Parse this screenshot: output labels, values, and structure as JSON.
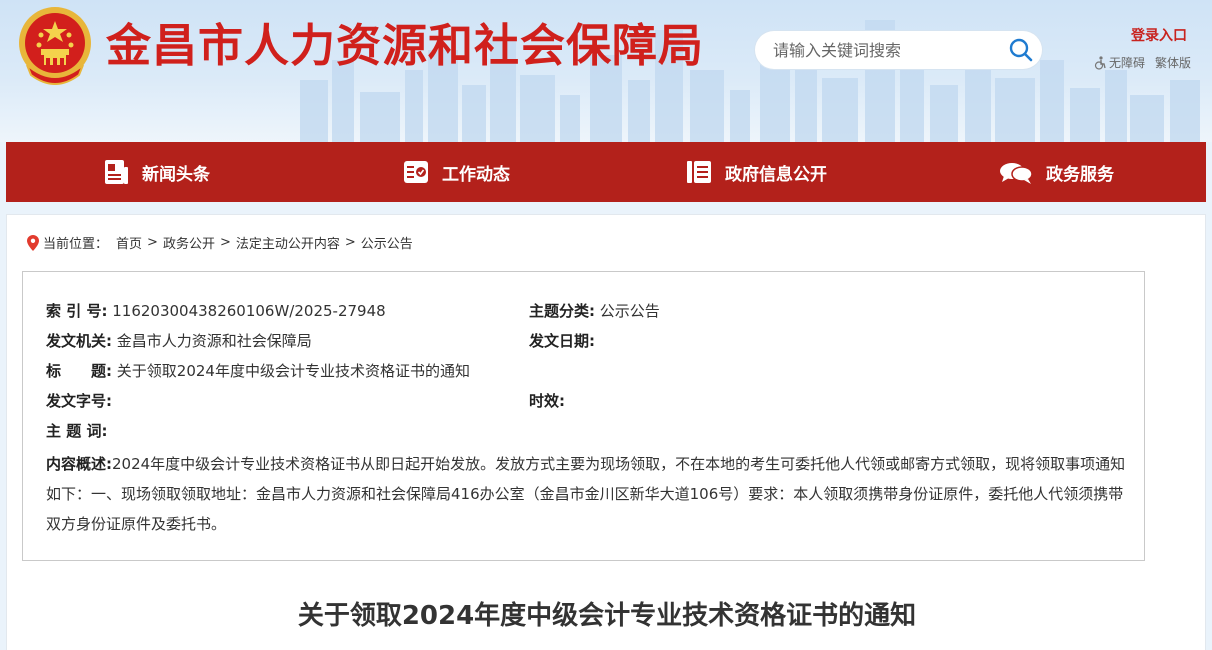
{
  "header": {
    "site_title": "金昌市人力资源和社会保障局",
    "search_placeholder": "请输入关键词搜索",
    "login": "登录入口",
    "accessibility": "无障碍",
    "traditional": "繁体版"
  },
  "nav": [
    {
      "label": "新闻头条",
      "icon": "news-icon"
    },
    {
      "label": "工作动态",
      "icon": "work-icon"
    },
    {
      "label": "政府信息公开",
      "icon": "list-icon"
    },
    {
      "label": "政务服务",
      "icon": "chat-icon"
    }
  ],
  "breadcrumb": {
    "prefix": "当前位置：",
    "items": [
      "首页",
      "政务公开",
      "法定主动公开内容",
      "公示公告"
    ]
  },
  "info": {
    "index_label": "索 引 号:",
    "index_value": "11620300438260106W/2025-27948",
    "category_label": "主题分类:",
    "category_value": "公示公告",
    "org_label": "发文机关:",
    "org_value": "金昌市人力资源和社会保障局",
    "date_label": "发文日期:",
    "date_value": "",
    "title_label": "标　　题:",
    "title_value": "关于领取2024年度中级会计专业技术资格证书的通知",
    "docno_label": "发文字号:",
    "docno_value": "",
    "validity_label": "时效:",
    "validity_value": "",
    "keywords_label": "主 题 词:",
    "keywords_value": "",
    "summary_label": "内容概述:",
    "summary_value": "2024年度中级会计专业技术资格证书从即日起开始发放。发放方式主要为现场领取，不在本地的考生可委托他人代领或邮寄方式领取，现将领取事项通知如下：一、现场领取领取地址：金昌市人力资源和社会保障局416办公室（金昌市金川区新华大道106号）要求：本人领取须携带身份证原件，委托他人代领须携带双方身份证原件及委托书。"
  },
  "article": {
    "title": "关于领取2024年度中级会计专业技术资格证书的通知"
  },
  "colors": {
    "brand_red": "#b3211b",
    "title_red": "#d0201c"
  }
}
